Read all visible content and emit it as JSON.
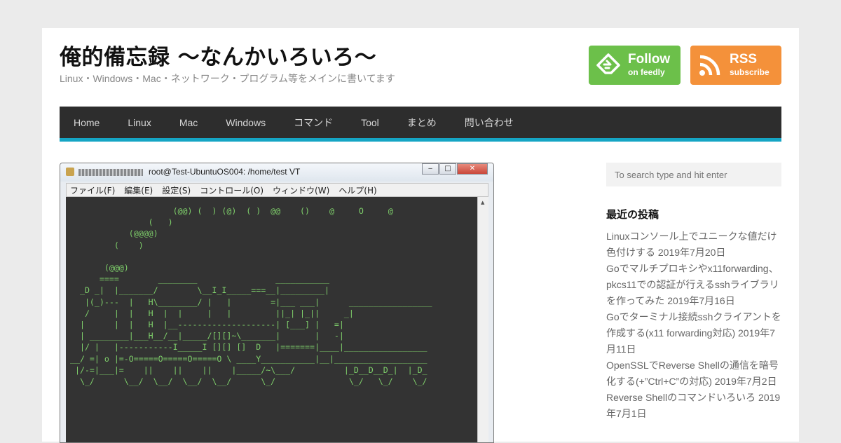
{
  "site": {
    "title": "俺的備忘録 〜なんかいろいろ〜",
    "description": "Linux・Windows・Mac・ネットワーク・プログラム等をメインに書いてます"
  },
  "social": {
    "feedly": {
      "main": "Follow",
      "sub": "on feedly",
      "color": "#6cc04a",
      "icon": "feedly-icon"
    },
    "rss": {
      "main": "RSS",
      "sub": "subscribe",
      "color": "#f4913a",
      "icon": "rss-icon"
    }
  },
  "nav": {
    "items": [
      "Home",
      "Linux",
      "Mac",
      "Windows",
      "コマンド",
      "Tool",
      "まとめ",
      "問い合わせ"
    ],
    "accent": "#15a5c4"
  },
  "screenshot": {
    "window_title": "root@Test-UbuntuOS004: /home/test VT",
    "menu": [
      "ファイル(F)",
      "編集(E)",
      "設定(S)",
      "コントロール(O)",
      "ウィンドウ(W)",
      "ヘルプ(H)"
    ],
    "terminal": "                     (@@) (  ) (@)  ( )  @@    ()    @     O     @\n                (   )\n            (@@@@)\n         (    )\n\n       (@@@)\n      ====        ________                ___________\n  _D _|  |_______/        \\__I_I_____===__|_________|\n   |(_)---  |   H\\________/ |   |        =|___ ___|      _________________\n   /     |  |   H  |  |     |   |         ||_| |_||     _|\n  |      |  |   H  |__--------------------| [___] |   =|\n  | ________|___H__/__|_____/[][]~\\_______|       |   -|\n  |/ |   |-----------I_____I [][] []  D   |=======|____|_________________\n__/ =| o |=-O=====O=====O=====O \\ ____Y___________|__|___________________\n |/-=|___|=    ||    ||    ||    |_____/~\\___/          |_D__D__D_|  |_D_\n  \\_/      \\__/  \\__/  \\__/  \\__/      \\_/               \\_/   \\_/    \\_/"
  },
  "search": {
    "placeholder": "To search type and hit enter"
  },
  "recent_posts": {
    "title": "最近の投稿",
    "items": [
      {
        "title": "Linuxコンソール上でユニークな値だけ色付けする",
        "date": "2019年7月20日"
      },
      {
        "title": "Goでマルチプロキシやx11forwarding、pkcs11での認証が行えるsshライブラリを作ってみた",
        "date": "2019年7月16日"
      },
      {
        "title": "Goでターミナル接続sshクライアントを作成する(x11 forwarding対応)",
        "date": "2019年7月11日"
      },
      {
        "title": "OpenSSLでReverse Shellの通信を暗号化する(+”Ctrl+C”の対応)",
        "date": "2019年7月2日"
      },
      {
        "title": "Reverse Shellのコマンドいろいろ",
        "date": "2019年7月1日"
      }
    ]
  }
}
